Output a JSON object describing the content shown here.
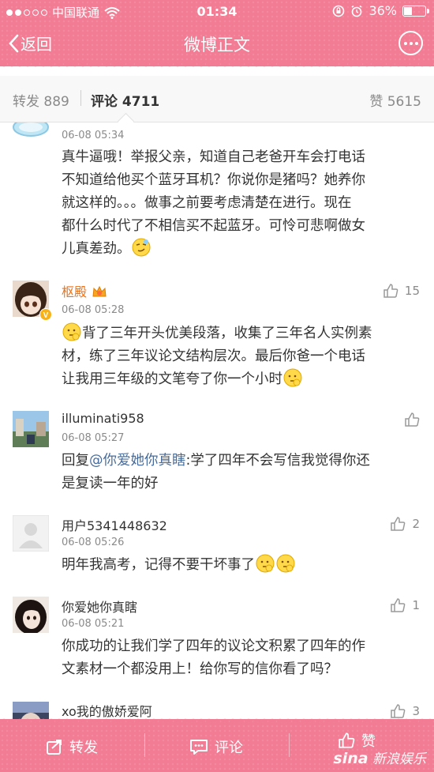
{
  "status_bar": {
    "carrier": "中国联通",
    "time": "01:34",
    "battery": "36%",
    "battery_level": 0.36
  },
  "nav": {
    "back_label": "返回",
    "title": "微博正文"
  },
  "tabs": {
    "repost": {
      "label": "转发",
      "count": "889"
    },
    "comment": {
      "label": "评论",
      "count": "4711"
    },
    "like": {
      "label": "赞",
      "count": "5615"
    }
  },
  "comments": [
    {
      "user": "",
      "time": "06-08 05:34",
      "likes": "",
      "text_lines": [
        "真牛逼哦！举报父亲，知道自己老爸开车会打电话",
        "不知道给他买个蓝牙耳机？你说你是猪吗？她养你",
        "就这样的。。。做事之前要考虑清楚在进行。现在",
        "都什么时代了不相信买不起蓝牙。可怜可悲啊做女",
        "儿真差劲。"
      ]
    },
    {
      "user": "枢殿",
      "time": "06-08 05:28",
      "likes": "15",
      "text_lines": [
        "背了三年开头优美段落，收集了三年名人实例素",
        "材，练了三年议论文结构层次。最后你爸一个电话",
        "让我用三年级的文笔夸了你一个小时"
      ]
    },
    {
      "user": "illuminati958",
      "time": "06-08 05:27",
      "likes": "",
      "reply_prefix": "回复",
      "mention": "@你爱她你真瞎",
      "text_lines": [
        ":学了四年不会写信我觉得你还",
        "是复读一年的好"
      ]
    },
    {
      "user": "用户5341448632",
      "time": "06-08 05:26",
      "likes": "2",
      "text_lines": [
        "明年我高考，记得不要干坏事了"
      ]
    },
    {
      "user": "你爱她你真瞎",
      "time": "06-08 05:21",
      "likes": "1",
      "text_lines": [
        "你成功的让我们学了四年的议论文积累了四年的作",
        "文素材一个都没用上！给你写的信你看了吗？"
      ]
    },
    {
      "user": "xo我的傲娇爱阿",
      "time": "",
      "likes": "3",
      "text_lines": []
    }
  ],
  "toolbar": {
    "repost_label": "转发",
    "comment_label": "评论",
    "like_label": "赞"
  },
  "watermark": {
    "brand": "sina",
    "text": "新浪娱乐"
  },
  "colors": {
    "theme_pink": "#f27c94",
    "mention_blue": "#476c9c",
    "vip_orange": "#e8731c"
  }
}
